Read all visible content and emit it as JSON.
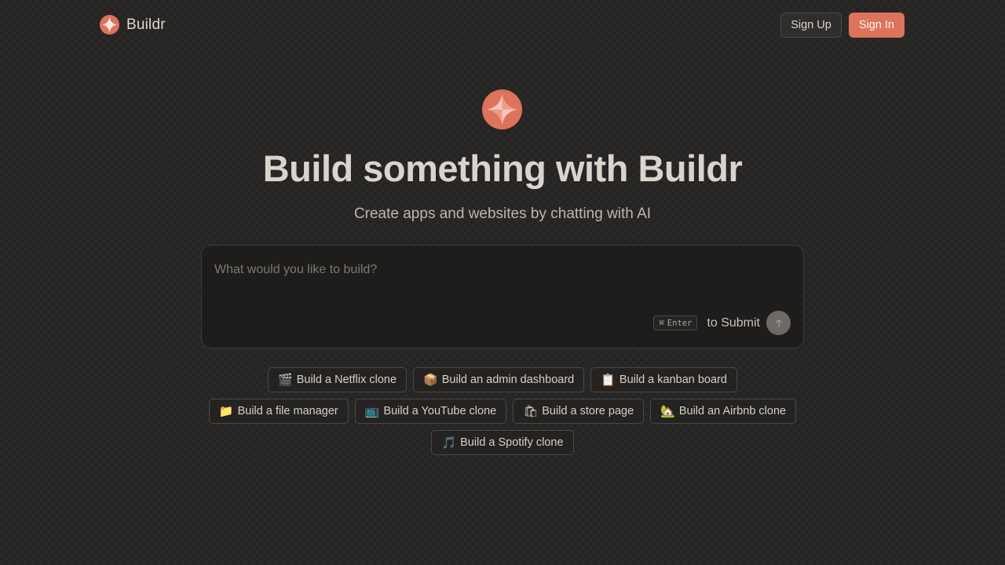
{
  "brand": {
    "name": "Buildr",
    "logo_icon": "buildr-logo-icon",
    "accent": "#dc735a"
  },
  "header": {
    "signup_label": "Sign Up",
    "signin_label": "Sign In"
  },
  "hero": {
    "title": "Build something with Buildr",
    "subtitle": "Create apps and websites by chatting with AI"
  },
  "composer": {
    "placeholder": "What would you like to build?",
    "value": "",
    "shortcut_symbol": "⌘",
    "shortcut_key": "Enter",
    "submit_hint": "to Submit",
    "send_icon": "arrow-up-icon"
  },
  "suggestions": {
    "rows": [
      [
        {
          "emoji": "🎬",
          "label": "Build a Netflix clone"
        },
        {
          "emoji": "📦",
          "label": "Build an admin dashboard"
        },
        {
          "emoji": "📋",
          "label": "Build a kanban board"
        }
      ],
      [
        {
          "emoji": "📁",
          "label": "Build a file manager"
        },
        {
          "emoji": "📺",
          "label": "Build a YouTube clone"
        },
        {
          "emoji": "🛍",
          "label": "Build a store page"
        },
        {
          "emoji": "🏡",
          "label": "Build an Airbnb clone"
        }
      ],
      [
        {
          "emoji": "🎵",
          "label": "Build a Spotify clone"
        }
      ]
    ]
  }
}
